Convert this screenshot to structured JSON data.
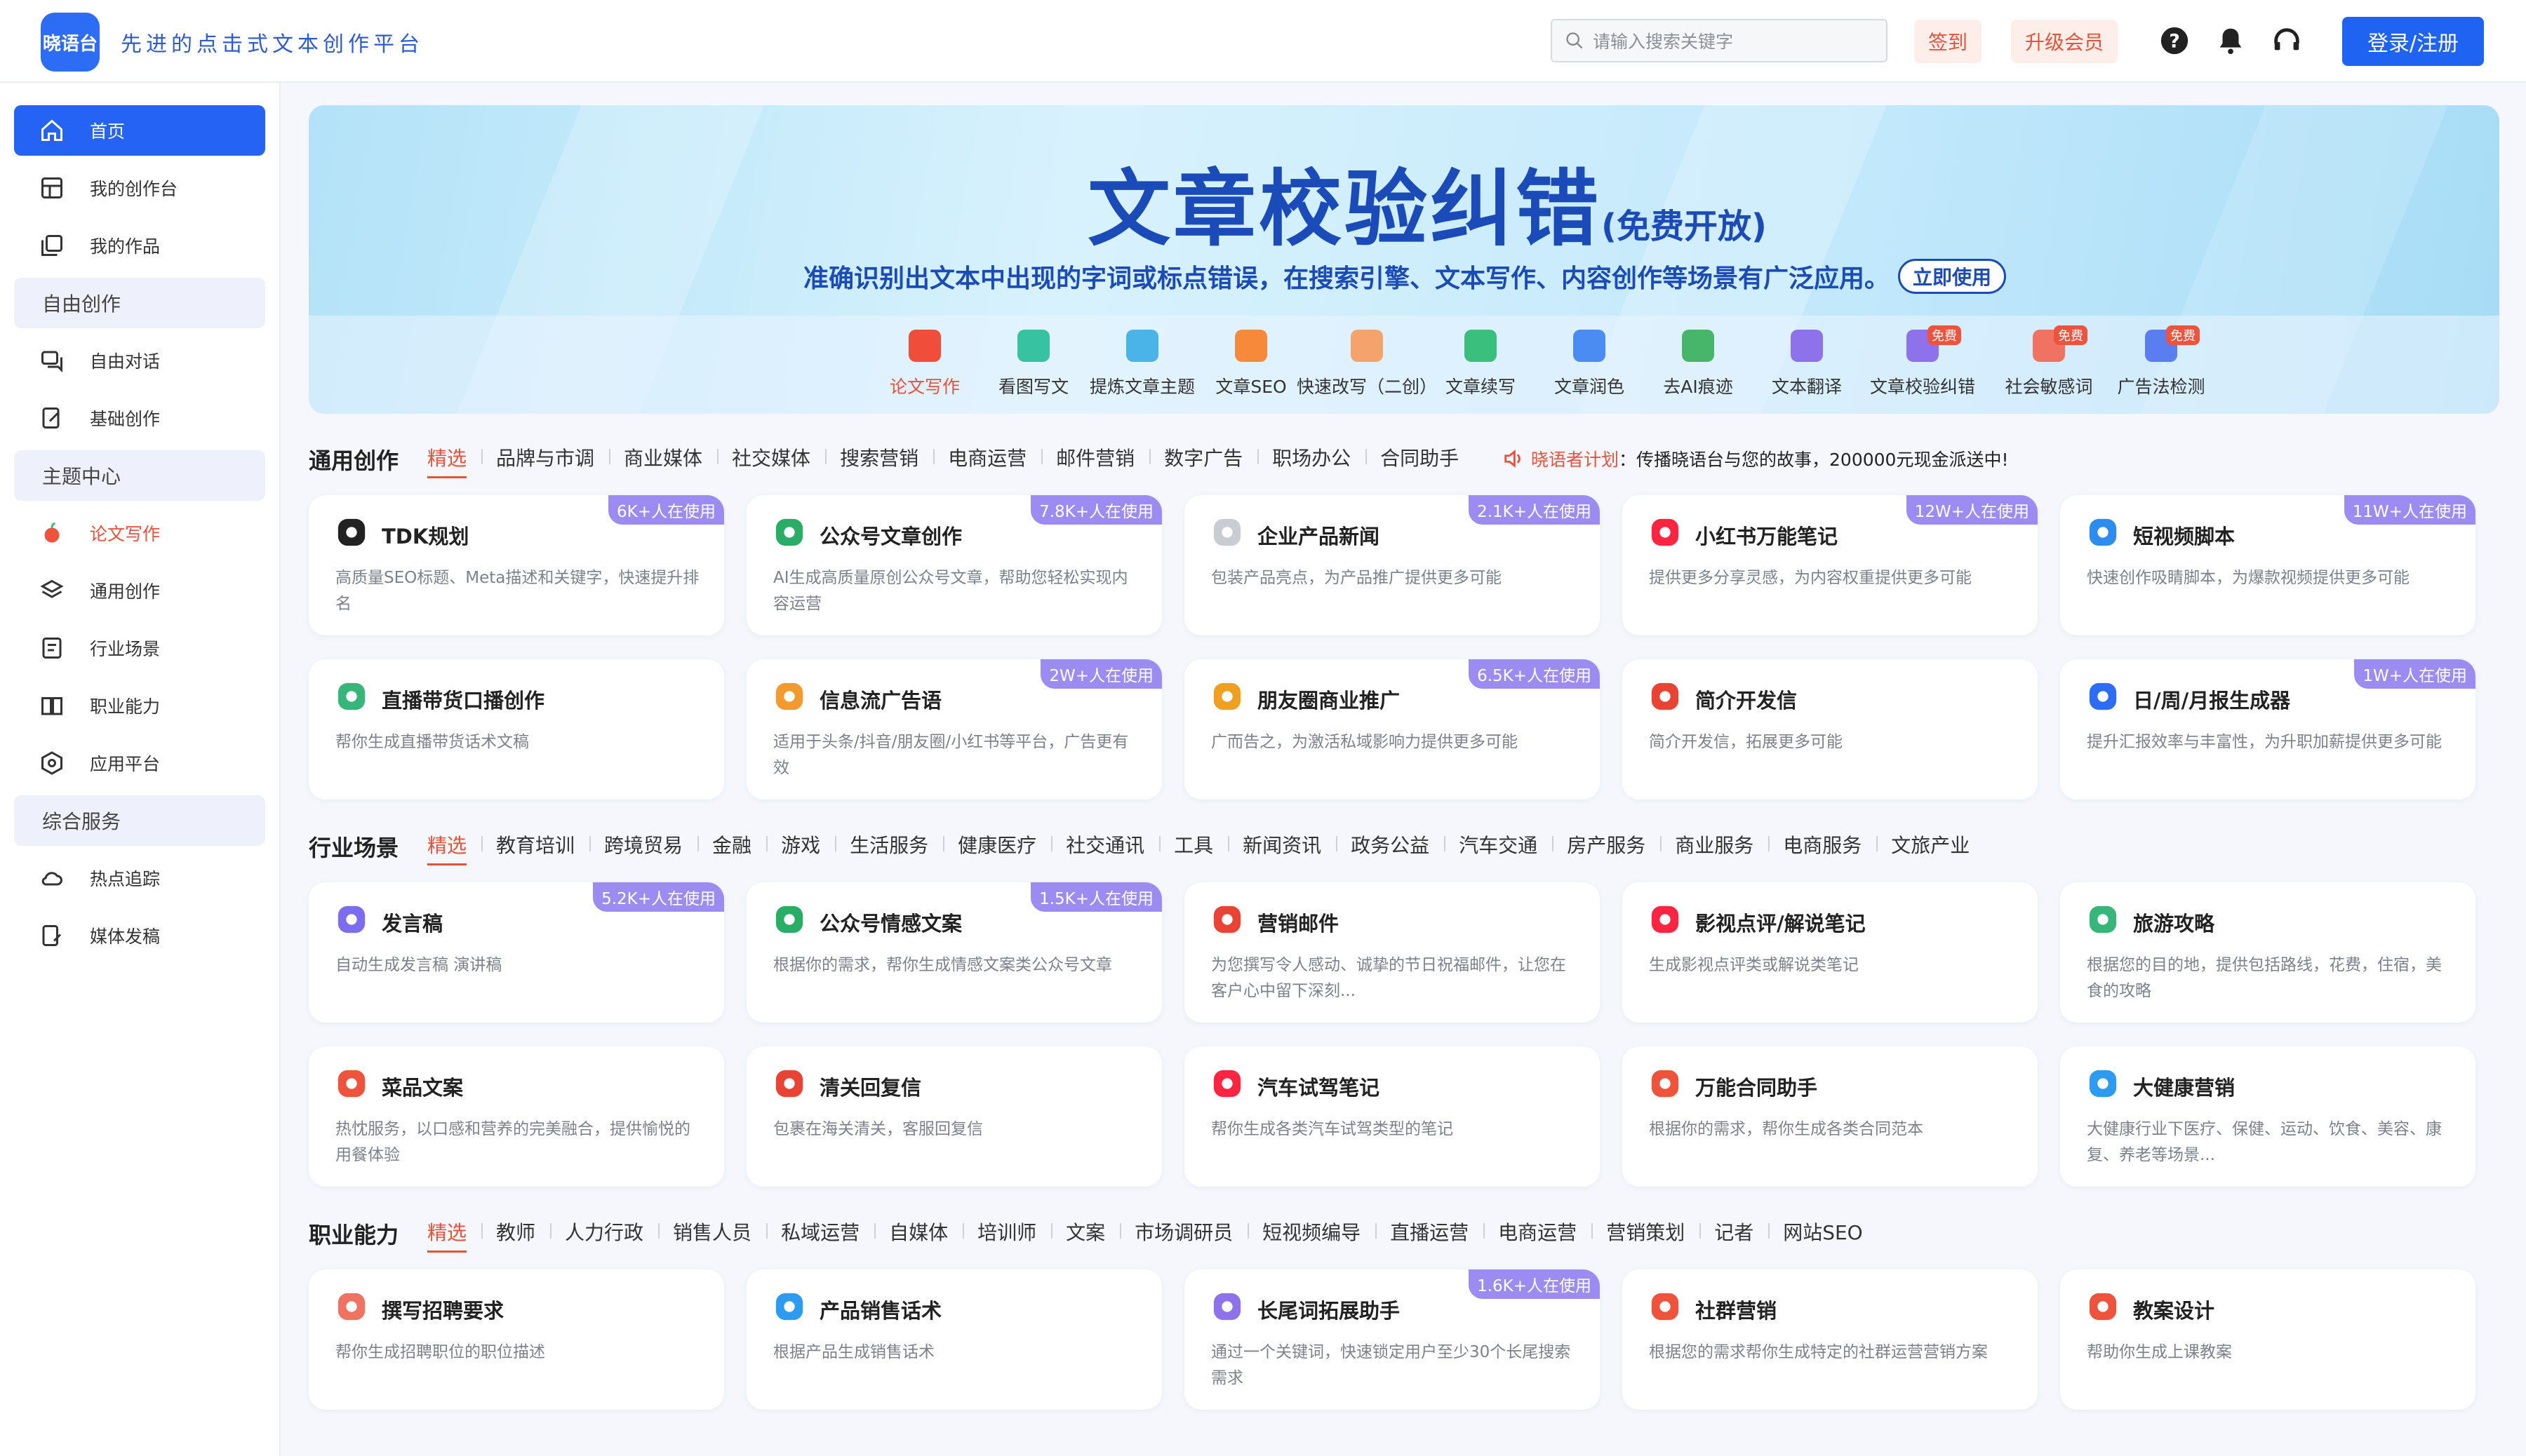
{
  "header": {
    "logo_text": "晓语台",
    "slogan": "先进的点击式文本创作平台",
    "search_placeholder": "请输入搜索关键字",
    "sign_label": "签到",
    "vip_label": "升级会员",
    "login_label": "登录/注册"
  },
  "sidebar": {
    "items": [
      {
        "label": "首页"
      },
      {
        "label": "我的创作台"
      },
      {
        "label": "我的作品"
      },
      {
        "group": "自由创作"
      },
      {
        "label": "自由对话"
      },
      {
        "label": "基础创作"
      },
      {
        "group": "主题中心"
      },
      {
        "label": "论文写作"
      },
      {
        "label": "通用创作"
      },
      {
        "label": "行业场景"
      },
      {
        "label": "职业能力"
      },
      {
        "label": "应用平台"
      },
      {
        "group": "综合服务"
      },
      {
        "label": "热点追踪"
      },
      {
        "label": "媒体发稿"
      }
    ]
  },
  "banner": {
    "title": "文章校验纠错",
    "title_suffix": "(免费开放)",
    "subtitle": "准确识别出文本中出现的字词或标点错误，在搜索引擎、文本写作、内容创作等场景有广泛应用。",
    "cta": "立即使用",
    "tools": [
      {
        "label": "论文写作",
        "color": "#f04e3a"
      },
      {
        "label": "看图写文",
        "color": "#37c2a1"
      },
      {
        "label": "提炼文章主题",
        "color": "#4ab3e8"
      },
      {
        "label": "文章SEO",
        "color": "#f7893a"
      },
      {
        "label": "快速改写（二创）",
        "color": "#f3a36b"
      },
      {
        "label": "文章续写",
        "color": "#3bbf7c"
      },
      {
        "label": "文章润色",
        "color": "#4a8cf1"
      },
      {
        "label": "去AI痕迹",
        "color": "#47b66b"
      },
      {
        "label": "文本翻译",
        "color": "#8e72ec"
      },
      {
        "label": "文章校验纠错",
        "color": "#8e72ec",
        "free": "免费"
      },
      {
        "label": "社会敏感词",
        "color": "#f07262",
        "free": "免费"
      },
      {
        "label": "广告法检测",
        "color": "#5a7df0",
        "free": "免费"
      }
    ]
  },
  "sections": {
    "general": {
      "title": "通用创作",
      "tabs": [
        "精选",
        "品牌与市调",
        "商业媒体",
        "社交媒体",
        "搜索营销",
        "电商运营",
        "邮件营销",
        "数字广告",
        "职场办公",
        "合同助手"
      ],
      "notice_label": "晓语者计划",
      "notice_text": "：传播晓语台与您的故事，200000元现金派送中!"
    },
    "industry": {
      "title": "行业场景",
      "tabs": [
        "精选",
        "教育培训",
        "跨境贸易",
        "金融",
        "游戏",
        "生活服务",
        "健康医疗",
        "社交通讯",
        "工具",
        "新闻资讯",
        "政务公益",
        "汽车交通",
        "房产服务",
        "商业服务",
        "电商服务",
        "文旅产业"
      ]
    },
    "career": {
      "title": "职业能力",
      "tabs": [
        "精选",
        "教师",
        "人力行政",
        "销售人员",
        "私域运营",
        "自媒体",
        "培训师",
        "文案",
        "市场调研员",
        "短视频编导",
        "直播运营",
        "电商运营",
        "营销策划",
        "记者",
        "网站SEO"
      ]
    }
  },
  "cards": [
    {
      "title": "TDK规划",
      "desc": "高质量SEO标题、Meta描述和关键字，快速提升排名",
      "badge": "6K+人在使用",
      "icon": "tdk-icon",
      "color": "#222222"
    },
    {
      "title": "公众号文章创作",
      "desc": "AI生成高质量原创公众号文章，帮助您轻松实现内容运营",
      "badge": "7.8K+人在使用",
      "icon": "wechat-icon",
      "color": "#2aae67"
    },
    {
      "title": "企业产品新闻",
      "desc": "包装产品亮点，为产品推广提供更多可能",
      "badge": "2.1K+人在使用",
      "icon": "news-icon",
      "color": "#c9ccd2"
    },
    {
      "title": "小红书万能笔记",
      "desc": "提供更多分享灵感，为内容权重提供更多可能",
      "badge": "12W+人在使用",
      "icon": "xiaohongshu-icon",
      "color": "#ff2442"
    },
    {
      "title": "短视频脚本",
      "desc": "快速创作吸睛脚本，为爆款视频提供更多可能",
      "badge": "11W+人在使用",
      "icon": "video-icon",
      "color": "#2d8cf0"
    },
    {
      "title": "直播带货口播创作",
      "desc": "帮你生成直播带货话术文稿",
      "badge": "",
      "icon": "live-icon",
      "color": "#37b67a"
    },
    {
      "title": "信息流广告语",
      "desc": "适用于头条/抖音/朋友圈/小红书等平台，广告更有效",
      "badge": "2W+人在使用",
      "icon": "ad-icon",
      "color": "#f39a2f"
    },
    {
      "title": "朋友圈商业推广",
      "desc": "广而告之，为激活私域影响力提供更多可能",
      "badge": "6.5K+人在使用",
      "icon": "moments-icon",
      "color": "#f0a020"
    },
    {
      "title": "简介开发信",
      "desc": "简介开发信，拓展更多可能",
      "badge": "",
      "icon": "gmail-icon",
      "color": "#e84335"
    },
    {
      "title": "日/周/月报生成器",
      "desc": "提升汇报效率与丰富性，为升职加薪提供更多可能",
      "badge": "1W+人在使用",
      "icon": "report-icon",
      "color": "#2d6df6"
    },
    {
      "title": "发言稿",
      "desc": "自动生成发言稿 演讲稿",
      "badge": "5.2K+人在使用",
      "icon": "speech-icon",
      "color": "#7b6cf0"
    },
    {
      "title": "公众号情感文案",
      "desc": "根据你的需求，帮你生成情感文案类公众号文章",
      "badge": "1.5K+人在使用",
      "icon": "wechat-icon",
      "color": "#2aae67"
    },
    {
      "title": "营销邮件",
      "desc": "为您撰写令人感动、诚挚的节日祝福邮件，让您在客户心中留下深刻...",
      "badge": "",
      "icon": "gmail-icon",
      "color": "#e84335"
    },
    {
      "title": "影视点评/解说笔记",
      "desc": "生成影视点评类或解说类笔记",
      "badge": "",
      "icon": "xiaohongshu-icon",
      "color": "#ff2442"
    },
    {
      "title": "旅游攻略",
      "desc": "根据您的目的地，提供包括路线，花费，住宿，美食的攻略",
      "badge": "",
      "icon": "travel-icon",
      "color": "#37b67a"
    },
    {
      "title": "菜品文案",
      "desc": "热忱服务，以口感和营养的完美融合，提供愉悦的用餐体验",
      "badge": "",
      "icon": "dish-icon",
      "color": "#f0533c"
    },
    {
      "title": "清关回复信",
      "desc": "包裹在海关清关，客服回复信",
      "badge": "",
      "icon": "gmail-icon",
      "color": "#e84335"
    },
    {
      "title": "汽车试驾笔记",
      "desc": "帮你生成各类汽车试驾类型的笔记",
      "badge": "",
      "icon": "xiaohongshu-icon",
      "color": "#ff2442"
    },
    {
      "title": "万能合同助手",
      "desc": "根据你的需求，帮你生成各类合同范本",
      "badge": "",
      "icon": "contract-icon",
      "color": "#f0533c"
    },
    {
      "title": "大健康营销",
      "desc": "大健康行业下医疗、保健、运动、饮食、美容、康复、养老等场景...",
      "badge": "",
      "icon": "health-icon",
      "color": "#2d9cf0"
    },
    {
      "title": "撰写招聘要求",
      "desc": "帮你生成招聘职位的职位描述",
      "badge": "",
      "icon": "hr-icon",
      "color": "#f07262"
    },
    {
      "title": "产品销售话术",
      "desc": "根据产品生成销售话术",
      "badge": "",
      "icon": "chat-icon",
      "color": "#2d9cf0"
    },
    {
      "title": "长尾词拓展助手",
      "desc": "通过一个关键词，快速锁定用户至少30个长尾搜索需求",
      "badge": "1.6K+人在使用",
      "icon": "tuo-icon",
      "color": "#8e72ec"
    },
    {
      "title": "社群营销",
      "desc": "根据您的需求帮你生成特定的社群运营营销方案",
      "badge": "",
      "icon": "group-icon",
      "color": "#f0533c"
    },
    {
      "title": "教案设计",
      "desc": "帮助你生成上课教案",
      "badge": "",
      "icon": "lesson-icon",
      "color": "#f0533c"
    }
  ]
}
